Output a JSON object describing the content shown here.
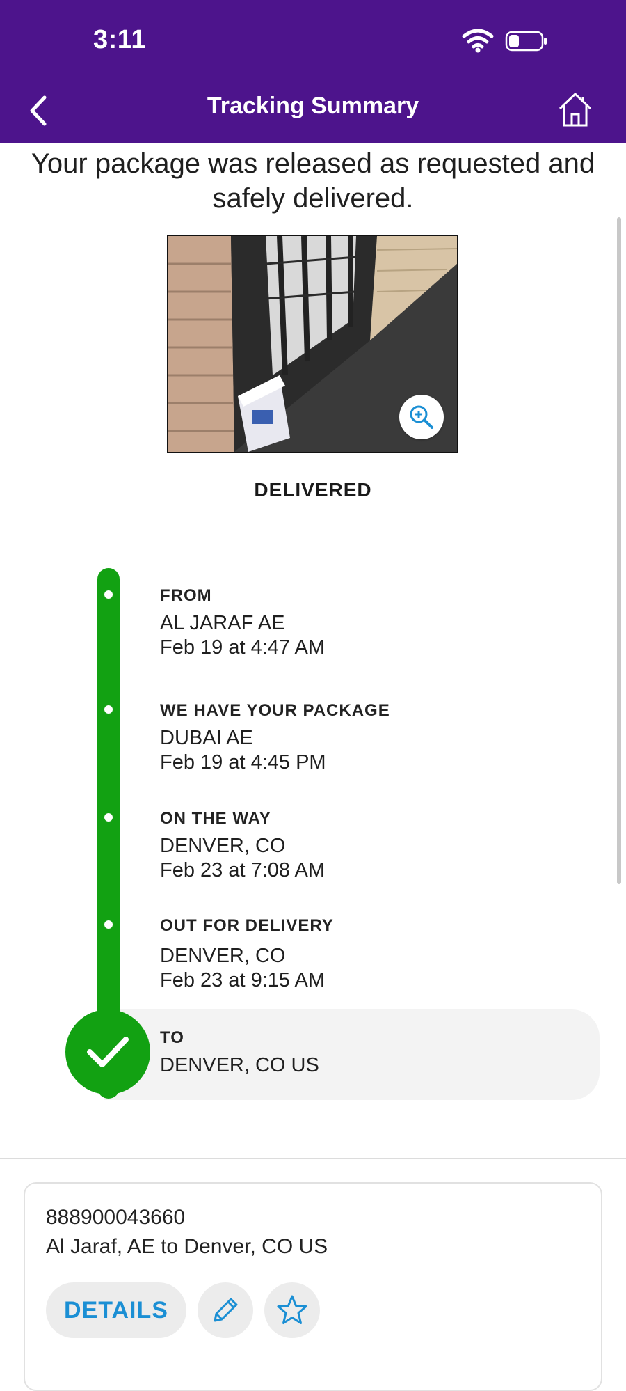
{
  "status_bar": {
    "time": "3:11",
    "wifi_icon": "wifi-icon",
    "battery_icon": "battery-icon"
  },
  "nav": {
    "title": "Tracking Summary",
    "back_icon": "chevron-left-icon",
    "home_icon": "home-icon"
  },
  "summary": {
    "message": "Your package was released as requested and safely delivered.",
    "status_label": "DELIVERED"
  },
  "photo": {
    "zoom_icon": "zoom-in-icon"
  },
  "timeline": [
    {
      "title": "FROM",
      "location": "AL JARAF AE",
      "time": "Feb 19 at 4:47 AM"
    },
    {
      "title": "WE HAVE YOUR PACKAGE",
      "location": "DUBAI AE",
      "time": "Feb 19 at 4:45 PM"
    },
    {
      "title": "ON THE WAY",
      "location": "DENVER, CO",
      "time": "Feb 23 at 7:08 AM"
    },
    {
      "title": "OUT FOR DELIVERY",
      "location": "DENVER, CO",
      "time": "Feb 23 at 9:15 AM"
    },
    {
      "title": "TO",
      "location": "DENVER, CO  US"
    }
  ],
  "shipment_card": {
    "tracking_number": "888900043660",
    "route": "Al Jaraf, AE to Denver, CO US",
    "details_label": "DETAILS",
    "edit_icon": "pencil-icon",
    "favorite_icon": "star-icon"
  },
  "colors": {
    "brand": "#4d148c",
    "progress": "#12a112",
    "link": "#1b8fd4"
  }
}
